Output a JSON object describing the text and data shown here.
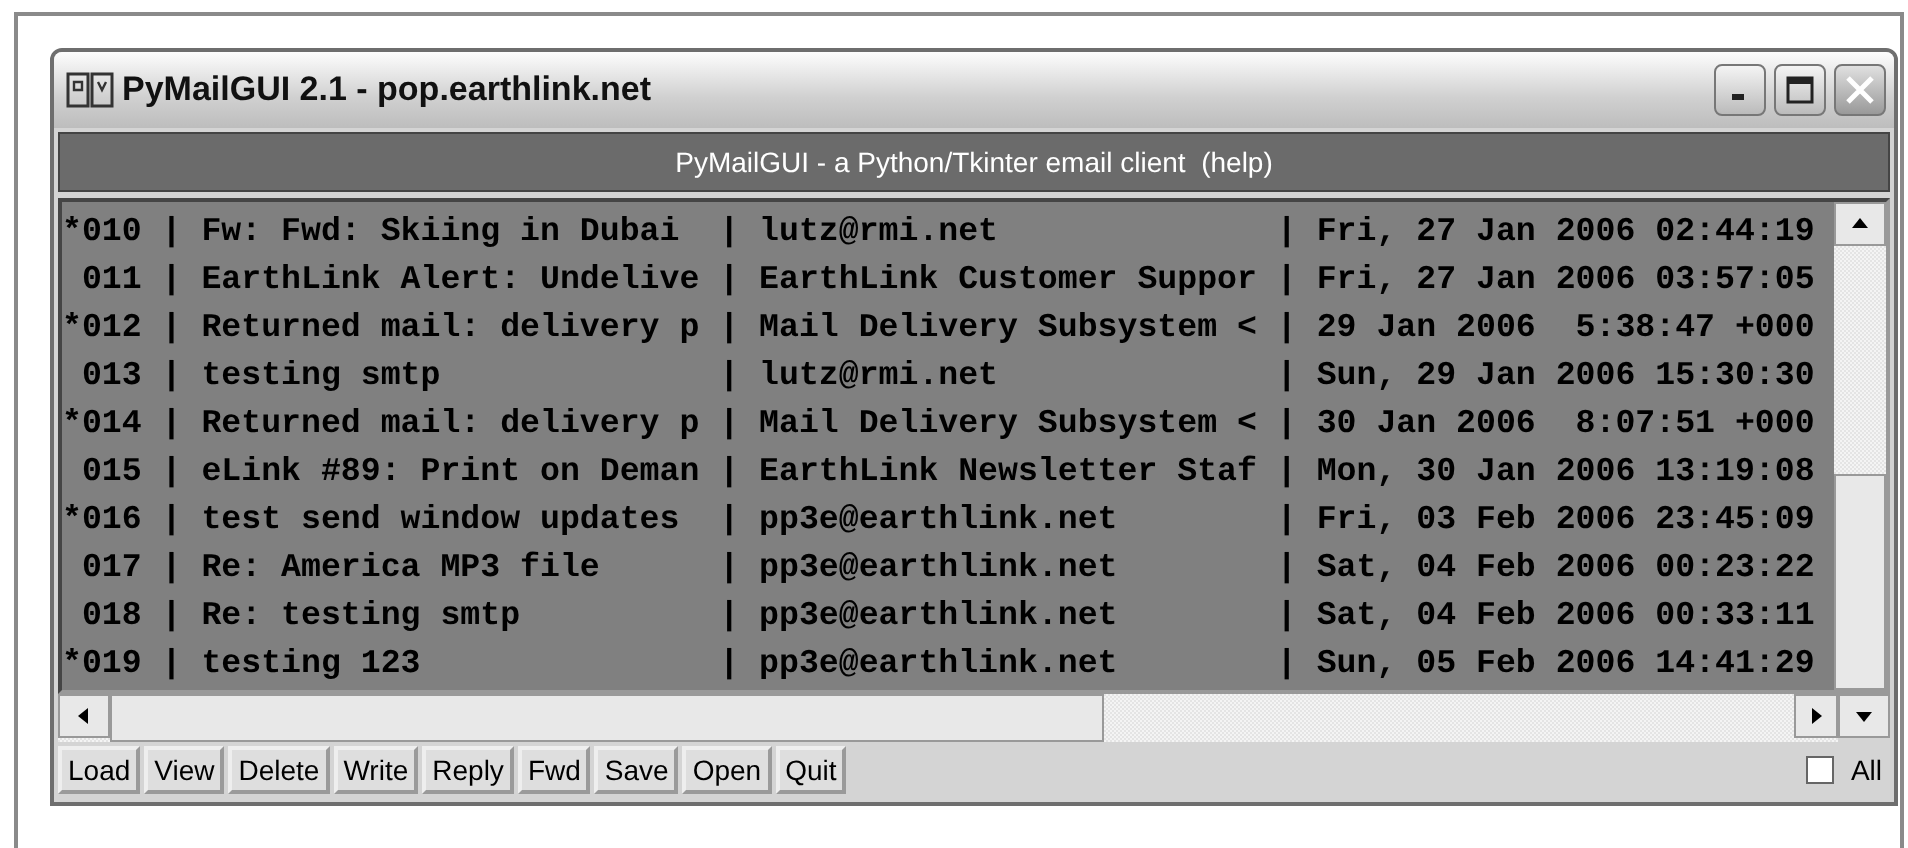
{
  "window": {
    "title": "PyMailGUI 2.1 - pop.earthlink.net"
  },
  "banner": "PyMailGUI - a Python/Tkinter email client  (help)",
  "messages": [
    {
      "line": "*010 | Fw: Fwd: Skiing in Dubai  | lutz@rmi.net              | Fri, 27 Jan 2006 02:44:19"
    },
    {
      "line": " 011 | EarthLink Alert: Undelive | EarthLink Customer Suppor | Fri, 27 Jan 2006 03:57:05"
    },
    {
      "line": "*012 | Returned mail: delivery p | Mail Delivery Subsystem < | 29 Jan 2006  5:38:47 +000"
    },
    {
      "line": " 013 | testing smtp              | lutz@rmi.net              | Sun, 29 Jan 2006 15:30:30"
    },
    {
      "line": "*014 | Returned mail: delivery p | Mail Delivery Subsystem < | 30 Jan 2006  8:07:51 +000"
    },
    {
      "line": " 015 | eLink #89: Print on Deman | EarthLink Newsletter Staf | Mon, 30 Jan 2006 13:19:08"
    },
    {
      "line": "*016 | test send window updates  | pp3e@earthlink.net        | Fri, 03 Feb 2006 23:45:09"
    },
    {
      "line": " 017 | Re: America MP3 file      | pp3e@earthlink.net        | Sat, 04 Feb 2006 00:23:22"
    },
    {
      "line": " 018 | Re: testing smtp          | pp3e@earthlink.net        | Sat, 04 Feb 2006 00:33:11"
    },
    {
      "line": "*019 | testing 123               | pp3e@earthlink.net        | Sun, 05 Feb 2006 14:41:29"
    }
  ],
  "buttons": [
    "Load",
    "View",
    "Delete",
    "Write",
    "Reply",
    "Fwd",
    "Save",
    "Open",
    "Quit"
  ],
  "all_checkbox": {
    "label": "All",
    "checked": false
  }
}
